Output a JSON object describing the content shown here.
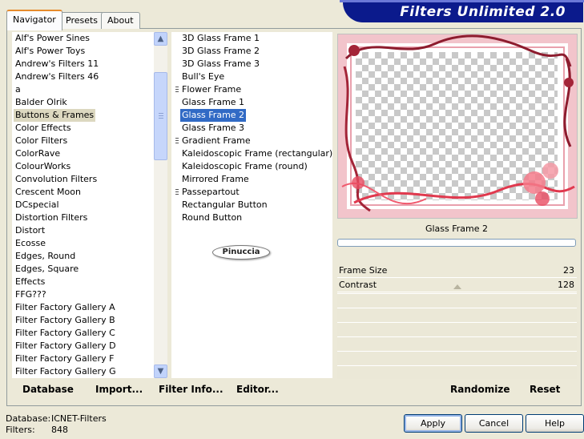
{
  "banner": {
    "title": "Filters Unlimited 2.0"
  },
  "tabs": [
    {
      "label": "Navigator",
      "active": true
    },
    {
      "label": "Presets",
      "active": false
    },
    {
      "label": "About",
      "active": false
    }
  ],
  "categories": {
    "items": [
      "Alf's Power Sines",
      "Alf's Power Toys",
      "Andrew's Filters 11",
      "Andrew's Filters 46",
      "a",
      "Balder Olrik",
      "Buttons & Frames",
      "Color Effects",
      "Color Filters",
      "ColorRave",
      "ColourWorks",
      "Convolution Filters",
      "Crescent Moon",
      "DCspecial",
      "Distortion Filters",
      "Distort",
      "Ecosse",
      "Edges, Round",
      "Edges, Square",
      "Effects",
      "FFG???",
      "Filter Factory Gallery A",
      "Filter Factory Gallery B",
      "Filter Factory Gallery C",
      "Filter Factory Gallery D",
      "Filter Factory Gallery F",
      "Filter Factory Gallery G"
    ],
    "highlighted": "Buttons & Frames"
  },
  "filters": {
    "items": [
      {
        "label": "3D Glass Frame 1",
        "marker": false
      },
      {
        "label": "3D Glass Frame 2",
        "marker": false
      },
      {
        "label": "3D Glass Frame 3",
        "marker": false
      },
      {
        "label": "Bull's Eye",
        "marker": false
      },
      {
        "label": "Flower Frame",
        "marker": true
      },
      {
        "label": "Glass Frame 1",
        "marker": false
      },
      {
        "label": "Glass Frame 2",
        "marker": false
      },
      {
        "label": "Glass Frame 3",
        "marker": false
      },
      {
        "label": "Gradient Frame",
        "marker": true
      },
      {
        "label": "Kaleidoscopic Frame (rectangular)",
        "marker": false
      },
      {
        "label": "Kaleidoscopic Frame (round)",
        "marker": false
      },
      {
        "label": "Mirrored Frame",
        "marker": false
      },
      {
        "label": "Passepartout",
        "marker": true
      },
      {
        "label": "Rectangular Button",
        "marker": false
      },
      {
        "label": "Round Button",
        "marker": false
      }
    ],
    "selected": "Glass Frame 2"
  },
  "watermark": "Pinuccia",
  "preview": {
    "filter_name": "Glass Frame 2"
  },
  "params": [
    {
      "label": "Frame Size",
      "value": "23"
    },
    {
      "label": "Contrast",
      "value": "128"
    }
  ],
  "bottom_left": [
    "Database",
    "Import...",
    "Filter Info...",
    "Editor..."
  ],
  "bottom_right": [
    "Randomize",
    "Reset"
  ],
  "status": {
    "db_label": "Database:",
    "db_value": "ICNET-Filters",
    "filters_label": "Filters:",
    "filters_value": "848"
  },
  "buttons": {
    "apply": "Apply",
    "cancel": "Cancel",
    "help": "Help"
  },
  "colors": {
    "banner": "#0b1a8c",
    "selection": "#316ac5",
    "frame_red": "#e0394e"
  }
}
